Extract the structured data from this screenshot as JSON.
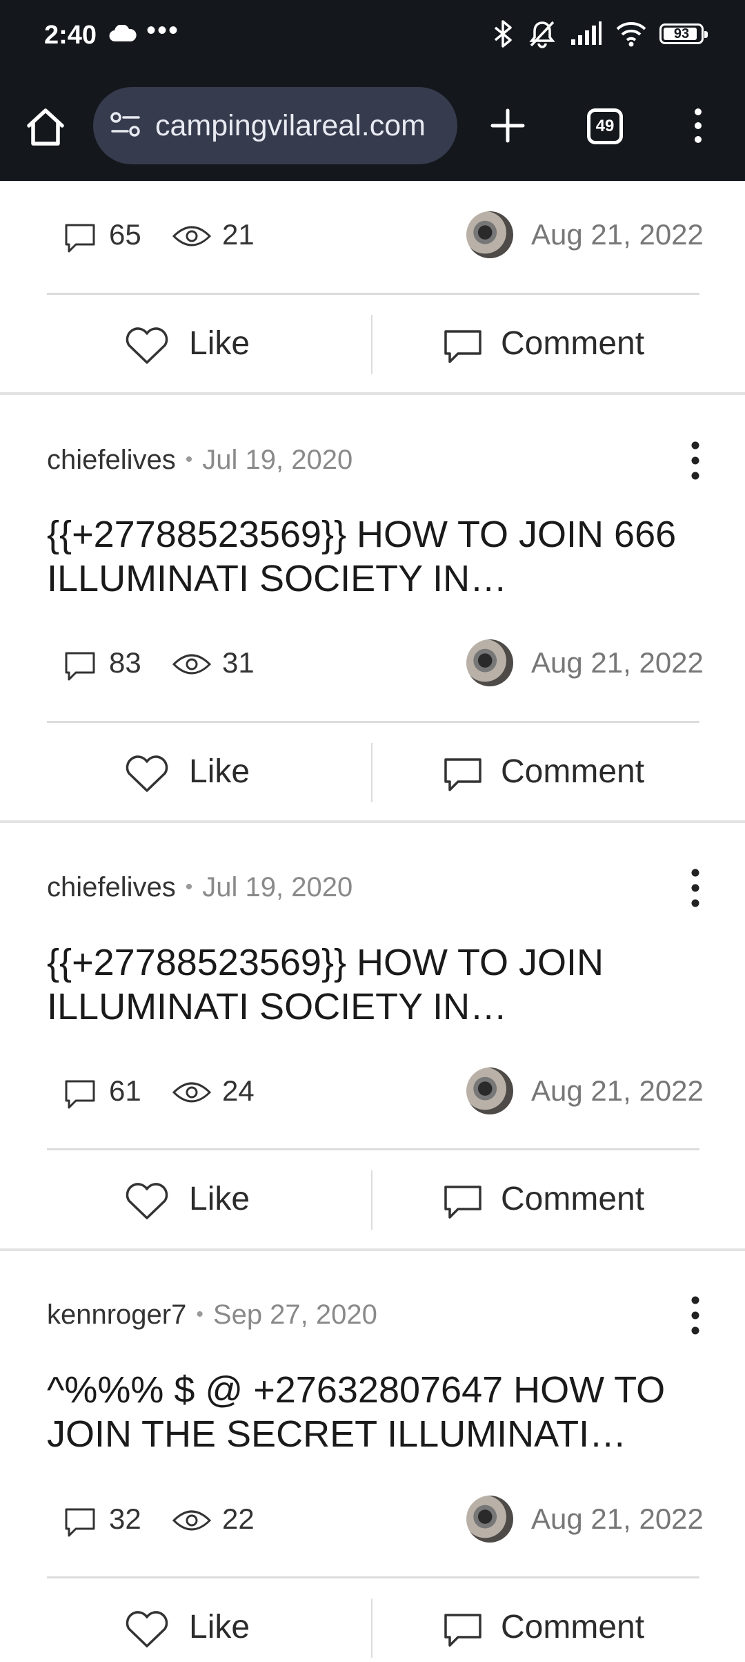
{
  "status_bar": {
    "time": "2:40",
    "dots": "•••",
    "battery": "93"
  },
  "browser": {
    "url": "campingvilareal.com",
    "tab_count": "49"
  },
  "top_partial": {
    "comments": "65",
    "views": "21",
    "date": "Aug 21, 2022"
  },
  "actions": {
    "like": "Like",
    "comment": "Comment"
  },
  "posts": [
    {
      "author": "chiefelives",
      "posted": "Jul 19, 2020",
      "title_line1": "{{+27788523569}} HOW TO JOIN 666",
      "title_line2": "ILLUMINATI SOCIETY IN…",
      "comments": "83",
      "views": "31",
      "date": "Aug 21, 2022"
    },
    {
      "author": "chiefelives",
      "posted": "Jul 19, 2020",
      "title_line1": "{{+27788523569}} HOW TO JOIN",
      "title_line2": "ILLUMINATI SOCIETY IN…",
      "comments": "61",
      "views": "24",
      "date": "Aug 21, 2022"
    },
    {
      "author": "kennroger7",
      "posted": "Sep 27, 2020",
      "title_line1": "^%%% $ @ +27632807647 HOW TO",
      "title_line2": "JOIN THE SECRET ILLUMINATI…",
      "comments": "32",
      "views": "22",
      "date": "Aug 21, 2022"
    }
  ]
}
